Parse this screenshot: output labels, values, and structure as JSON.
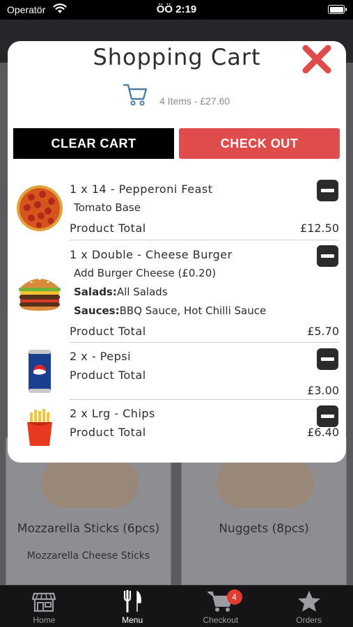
{
  "status_bar": {
    "carrier": "Operatör",
    "time": "ÖÖ 2:19"
  },
  "background": {
    "cards": [
      {
        "title": "Mozzarella Sticks (6pcs)",
        "subtitle": "Mozzarella Cheese Sticks"
      },
      {
        "title": "Nuggets (8pcs)",
        "subtitle": ""
      }
    ]
  },
  "cart": {
    "title": "Shopping Cart",
    "summary": "4 Items - £27.60",
    "clear_label": "CLEAR CART",
    "checkout_label": "CHECK OUT",
    "items": [
      {
        "title": "1 x 14 - Pepperoni Feast",
        "modifiers": [
          "Tomato Base"
        ],
        "total_label": "Product Total",
        "total": "£12.50",
        "image_icon": "pizza-icon"
      },
      {
        "title": "1 x Double - Cheese Burger",
        "modifiers": [
          "Add Burger Cheese (£0.20)"
        ],
        "salads_label": "Salads:",
        "salads_value": "All Salads",
        "sauces_label": "Sauces:",
        "sauces_value": "BBQ Sauce, Hot Chilli Sauce",
        "total_label": "Product Total",
        "total": "£5.70",
        "image_icon": "burger-icon"
      },
      {
        "title": "2 x - Pepsi",
        "total_label": "Product Total",
        "total": "£3.00",
        "image_icon": "pepsi-can-icon"
      },
      {
        "title": "2 x Lrg - Chips",
        "total_label": "Product Total",
        "total": "£6.40",
        "image_icon": "chips-icon"
      }
    ]
  },
  "tab_bar": {
    "tabs": [
      {
        "label": "Home",
        "icon": "store-icon"
      },
      {
        "label": "Menu",
        "icon": "fork-knife-icon",
        "active": true
      },
      {
        "label": "Checkout",
        "icon": "cart-icon",
        "badge": "4"
      },
      {
        "label": "Orders",
        "icon": "star-icon"
      }
    ]
  },
  "colors": {
    "checkout_button": "#e04b4b",
    "close_icon": "#e04b4b",
    "badge": "#e23b2e",
    "clear_button": "#000000"
  }
}
